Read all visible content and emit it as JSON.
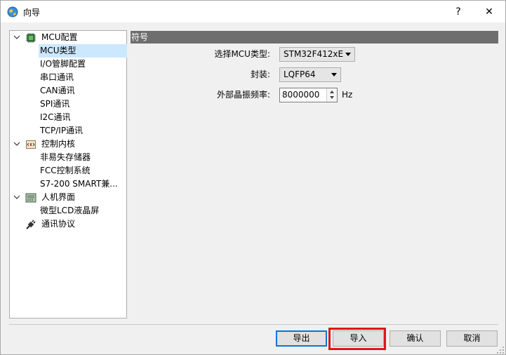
{
  "window": {
    "title": "向导",
    "help": "?",
    "close": "✕"
  },
  "tree": {
    "nodes": [
      {
        "label": "MCU配置"
      },
      {
        "label": "MCU类型"
      },
      {
        "label": "I/O管脚配置"
      },
      {
        "label": "串口通讯"
      },
      {
        "label": "CAN通讯"
      },
      {
        "label": "SPI通讯"
      },
      {
        "label": "I2C通讯"
      },
      {
        "label": "TCP/IP通讯"
      },
      {
        "label": "控制内核"
      },
      {
        "label": "非易失存储器"
      },
      {
        "label": "FCC控制系统"
      },
      {
        "label": "S7-200 SMART兼..."
      },
      {
        "label": "人机界面"
      },
      {
        "label": "微型LCD液晶屏"
      },
      {
        "label": "通讯协议"
      }
    ]
  },
  "panel": {
    "header": "符号",
    "mcu_type_label": "选择MCU类型:",
    "mcu_type_value": "STM32F412xE",
    "package_label": "封装:",
    "package_value": "LQFP64",
    "crystal_label": "外部晶振频率:",
    "crystal_value": "8000000",
    "crystal_unit": "Hz"
  },
  "buttons": {
    "export": "导出",
    "import": "导入",
    "ok": "确认",
    "cancel": "取消"
  },
  "colors": {
    "selection": "#cce8ff",
    "header_bg": "#6e6e6e",
    "highlight": "#e0141c",
    "default_button_border": "#0078d7"
  }
}
